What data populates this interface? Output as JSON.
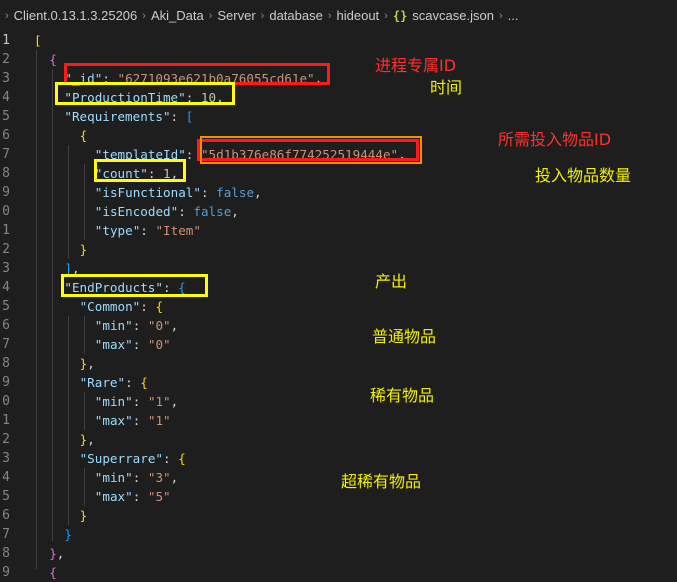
{
  "breadcrumb": {
    "items": [
      "Client.0.13.1.3.25206",
      "Aki_Data",
      "Server",
      "database",
      "hideout"
    ],
    "file_icon": "{}",
    "file": "scavcase.json",
    "trailing": "..."
  },
  "editor": {
    "lines": [
      {
        "number": "1",
        "tokens": [
          [
            "br1",
            "["
          ]
        ]
      },
      {
        "number": "2",
        "tokens": [
          [
            "br2",
            "{"
          ]
        ]
      },
      {
        "number": "3",
        "tokens": [
          [
            "k",
            "\"_id\""
          ],
          [
            "p",
            ": "
          ],
          [
            "s",
            "\"6271093e621b0a76055cd61e\""
          ],
          [
            "p",
            ","
          ]
        ]
      },
      {
        "number": "4",
        "tokens": [
          [
            "k",
            "\"ProductionTime\""
          ],
          [
            "p",
            ": "
          ],
          [
            "n",
            "10"
          ],
          [
            "p",
            ","
          ]
        ]
      },
      {
        "number": "5",
        "tokens": [
          [
            "k",
            "\"Requirements\""
          ],
          [
            "p",
            ": "
          ],
          [
            "br3",
            "["
          ]
        ]
      },
      {
        "number": "6",
        "tokens": [
          [
            "br1",
            "{"
          ]
        ]
      },
      {
        "number": "7",
        "tokens": [
          [
            "k",
            "\"templateId\""
          ],
          [
            "p",
            ": "
          ],
          [
            "s",
            "\"5d1b376e86f774252519444e\""
          ],
          [
            "p",
            ","
          ]
        ]
      },
      {
        "number": "8",
        "tokens": [
          [
            "k",
            "\"count\""
          ],
          [
            "p",
            ": "
          ],
          [
            "n",
            "1"
          ],
          [
            "p",
            ","
          ]
        ]
      },
      {
        "number": "9",
        "tokens": [
          [
            "k",
            "\"isFunctional\""
          ],
          [
            "p",
            ": "
          ],
          [
            "b",
            "false"
          ],
          [
            "p",
            ","
          ]
        ]
      },
      {
        "number": "0",
        "tokens": [
          [
            "k",
            "\"isEncoded\""
          ],
          [
            "p",
            ": "
          ],
          [
            "b",
            "false"
          ],
          [
            "p",
            ","
          ]
        ]
      },
      {
        "number": "1",
        "tokens": [
          [
            "k",
            "\"type\""
          ],
          [
            "p",
            ": "
          ],
          [
            "s",
            "\"Item\""
          ]
        ]
      },
      {
        "number": "2",
        "tokens": [
          [
            "br1",
            "}"
          ]
        ]
      },
      {
        "number": "3",
        "tokens": [
          [
            "br3",
            "]"
          ],
          [
            "p",
            ","
          ]
        ]
      },
      {
        "number": "4",
        "tokens": [
          [
            "k",
            "\"EndProducts\""
          ],
          [
            "p",
            ": "
          ],
          [
            "br3",
            "{"
          ]
        ]
      },
      {
        "number": "5",
        "tokens": [
          [
            "k",
            "\"Common\""
          ],
          [
            "p",
            ": "
          ],
          [
            "br1",
            "{"
          ]
        ]
      },
      {
        "number": "6",
        "tokens": [
          [
            "k",
            "\"min\""
          ],
          [
            "p",
            ": "
          ],
          [
            "s",
            "\"0\""
          ],
          [
            "p",
            ","
          ]
        ]
      },
      {
        "number": "7",
        "tokens": [
          [
            "k",
            "\"max\""
          ],
          [
            "p",
            ": "
          ],
          [
            "s",
            "\"0\""
          ]
        ]
      },
      {
        "number": "8",
        "tokens": [
          [
            "br1",
            "}"
          ],
          [
            "p",
            ","
          ]
        ]
      },
      {
        "number": "9",
        "tokens": [
          [
            "k",
            "\"Rare\""
          ],
          [
            "p",
            ": "
          ],
          [
            "br1",
            "{"
          ]
        ]
      },
      {
        "number": "0",
        "tokens": [
          [
            "k",
            "\"min\""
          ],
          [
            "p",
            ": "
          ],
          [
            "s",
            "\"1\""
          ],
          [
            "p",
            ","
          ]
        ]
      },
      {
        "number": "1",
        "tokens": [
          [
            "k",
            "\"max\""
          ],
          [
            "p",
            ": "
          ],
          [
            "s",
            "\"1\""
          ]
        ]
      },
      {
        "number": "2",
        "tokens": [
          [
            "br1",
            "}"
          ],
          [
            "p",
            ","
          ]
        ]
      },
      {
        "number": "3",
        "tokens": [
          [
            "k",
            "\"Superrare\""
          ],
          [
            "p",
            ": "
          ],
          [
            "br1",
            "{"
          ]
        ]
      },
      {
        "number": "4",
        "tokens": [
          [
            "k",
            "\"min\""
          ],
          [
            "p",
            ": "
          ],
          [
            "s",
            "\"3\""
          ],
          [
            "p",
            ","
          ]
        ]
      },
      {
        "number": "5",
        "tokens": [
          [
            "k",
            "\"max\""
          ],
          [
            "p",
            ": "
          ],
          [
            "s",
            "\"5\""
          ]
        ]
      },
      {
        "number": "6",
        "tokens": [
          [
            "br1",
            "}"
          ]
        ]
      },
      {
        "number": "7",
        "tokens": [
          [
            "br3",
            "}"
          ]
        ]
      },
      {
        "number": "8",
        "tokens": [
          [
            "br2",
            "}"
          ],
          [
            "p",
            ","
          ]
        ]
      },
      {
        "number": "9",
        "tokens": [
          [
            "br2",
            "{"
          ]
        ]
      }
    ]
  },
  "annotations": {
    "id_note": "进程专属ID",
    "time_note": "时间",
    "required_item_note": "所需投入物品ID",
    "count_note": "投入物品数量",
    "output_note": "产出",
    "common_note": "普通物品",
    "rare_note": "稀有物品",
    "superrare_note": "超稀有物品"
  },
  "colors": {
    "background": "#1e1e1e",
    "key": "#9cdcfe",
    "string": "#ce9178",
    "number": "#b5cea8",
    "boolean": "#569cd6",
    "annotation_red": "#ff1a1a",
    "annotation_yellow": "#ffff00"
  }
}
